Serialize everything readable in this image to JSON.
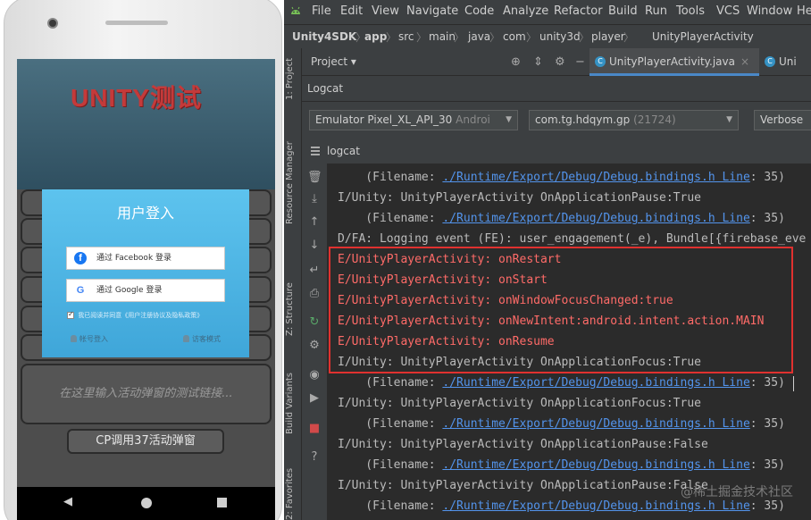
{
  "emulator": {
    "banner_title": "UNITY测试",
    "login": {
      "title": "用户登入",
      "facebook_label": "通过 Facebook 登录",
      "google_label": "通过 Google 登录",
      "agree_text": "我已阅读并同意《用户注册协议及隐私政策》",
      "account_login": "帐号登入",
      "guest_mode": "访客模式"
    },
    "input_placeholder": "在这里输入活动弹窗的测试链接...",
    "cp_button": "CP调用37活动弹窗"
  },
  "ide": {
    "menu": [
      "File",
      "Edit",
      "View",
      "Navigate",
      "Code",
      "Analyze",
      "Refactor",
      "Build",
      "Run",
      "Tools",
      "VCS",
      "Window",
      "He"
    ],
    "breadcrumbs": [
      "Unity4SDK",
      "app",
      "src",
      "main",
      "java",
      "com",
      "unity3d",
      "player",
      "UnityPlayerActivity"
    ],
    "side_labels": [
      "1: Project",
      "Resource Manager",
      "Z: Structure",
      "Build Variants",
      "2: Favorites"
    ],
    "project_tab": "Project",
    "file_tabs": [
      "UnityPlayerActivity.java",
      "Uni"
    ],
    "tool_window": "Logcat",
    "device": "Emulator Pixel_XL_API_30",
    "device_suffix": "Androi",
    "process_name": "com.tg.hdqym.gp",
    "process_pid": "(21724)",
    "log_level": "Verbose",
    "logcat_label": "logcat",
    "log_lines": [
      {
        "pre": "    (Filename: ",
        "link": "./Runtime/Export/Debug/Debug.bindings.h Line",
        "post": ": 35)"
      },
      {
        "text": "I/Unity: UnityPlayerActivity OnApplicationPause:True"
      },
      {
        "pre": "    (Filename: ",
        "link": "./Runtime/Export/Debug/Debug.bindings.h Line",
        "post": ": 35)"
      },
      {
        "text": "D/FA: Logging event (FE): user_engagement(_e), Bundle[{firebase_eve"
      },
      {
        "text": "E/UnityPlayerActivity: onRestart",
        "level": "error"
      },
      {
        "text": "E/UnityPlayerActivity: onStart",
        "level": "error"
      },
      {
        "text": "E/UnityPlayerActivity: onWindowFocusChanged:true",
        "level": "error"
      },
      {
        "text": "E/UnityPlayerActivity: onNewIntent:android.intent.action.MAIN",
        "level": "error"
      },
      {
        "text": "E/UnityPlayerActivity: onResume",
        "level": "error"
      },
      {
        "text": "I/Unity: UnityPlayerActivity OnApplicationFocus:True"
      },
      {
        "pre": "    (Filename: ",
        "link": "./Runtime/Export/Debug/Debug.bindings.h Line",
        "post": ": 35)"
      },
      {
        "text": "I/Unity: UnityPlayerActivity OnApplicationFocus:True"
      },
      {
        "pre": "    (Filename: ",
        "link": "./Runtime/Export/Debug/Debug.bindings.h Line",
        "post": ": 35)"
      },
      {
        "text": "I/Unity: UnityPlayerActivity OnApplicationPause:False"
      },
      {
        "pre": "    (Filename: ",
        "link": "./Runtime/Export/Debug/Debug.bindings.h Line",
        "post": ": 35)"
      },
      {
        "text": "I/Unity: UnityPlayerActivity OnApplicationPause:False"
      },
      {
        "pre": "    (Filename: ",
        "link": "./Runtime/Export/Debug/Debug.bindings.h Line",
        "post": ": 35)"
      }
    ],
    "watermark": "@稀土掘金技术社区",
    "colors": {
      "error": "#ff6b68",
      "info": "#bbbbbb",
      "link": "#5394ec",
      "highlight": "#e0312f"
    }
  }
}
